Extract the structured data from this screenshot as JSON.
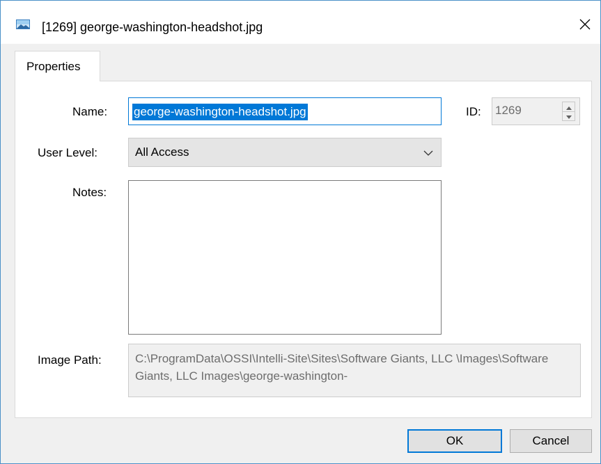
{
  "window": {
    "title": "[1269] george-washington-headshot.jpg",
    "app_icon": "image-file-icon",
    "close_icon": "close-icon"
  },
  "tabs": [
    {
      "label": "Properties",
      "active": true
    }
  ],
  "form": {
    "name_label": "Name:",
    "name_value": "george-washington-headshot.jpg",
    "name_selected": true,
    "id_label": "ID:",
    "id_value": "1269",
    "user_level_label": "User Level:",
    "user_level_value": "All Access",
    "notes_label": "Notes:",
    "notes_value": "",
    "image_path_label": "Image Path:",
    "image_path_value": "C:\\ProgramData\\OSSI\\Intelli-Site\\Sites\\Software Giants, LLC \\Images\\Software Giants, LLC Images\\george-washington-"
  },
  "buttons": {
    "ok_label": "OK",
    "cancel_label": "Cancel"
  },
  "colors": {
    "accent": "#0078d7",
    "window_border": "#4a90c8",
    "disabled_text": "#6d6d6d"
  }
}
